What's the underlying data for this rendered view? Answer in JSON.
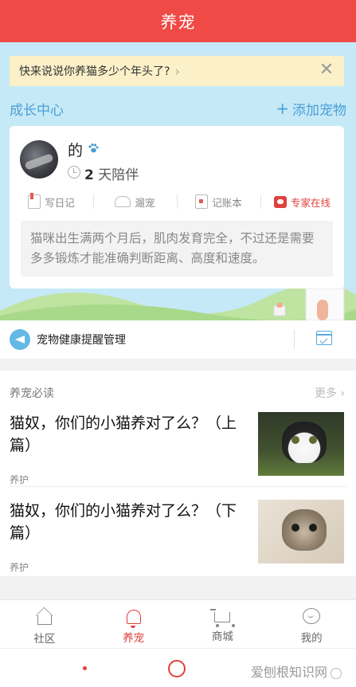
{
  "header": {
    "title": "养宠"
  },
  "banner": {
    "text": "快来说说你养猫多少个年头了?",
    "chevron": "›",
    "close": "✕"
  },
  "growth": {
    "title": "成长中心",
    "add_label": "添加宠物",
    "add_icon": "+"
  },
  "pet": {
    "name": "的",
    "days_number": "2",
    "days_suffix": "天陪伴",
    "actions": [
      {
        "label": "写日记",
        "icon": "diary-icon"
      },
      {
        "label": "遛宠",
        "icon": "walk-icon"
      },
      {
        "label": "记账本",
        "icon": "ledger-icon"
      },
      {
        "label": "专家在线",
        "icon": "chat-icon"
      }
    ],
    "tip": "猫咪出生满两个月后，肌肉发育完全，不过还是需要多多锻炼才能准确判断距离、高度和速度。"
  },
  "health": {
    "label": "宠物健康提醒管理"
  },
  "reads": {
    "title": "养宠必读",
    "more": "更多 ›",
    "articles": [
      {
        "title": "猫奴，你们的小猫养对了么？（上篇）",
        "tag": "养护"
      },
      {
        "title": "猫奴，你们的小猫养对了么？（下篇）",
        "tag": "养护"
      }
    ]
  },
  "tabbar": {
    "tabs": [
      {
        "label": "社区",
        "icon": "home-icon"
      },
      {
        "label": "养宠",
        "icon": "bell-icon"
      },
      {
        "label": "商城",
        "icon": "cart-icon"
      },
      {
        "label": "我的",
        "icon": "profile-icon"
      }
    ],
    "active": "养宠"
  },
  "watermark": {
    "text": "爱刨根知识网"
  },
  "colors": {
    "brand_red": "#ef4a45",
    "accent_blue": "#4a9fd6",
    "sky": "#c6e9f7",
    "banner_bg": "#fbf0c8"
  }
}
